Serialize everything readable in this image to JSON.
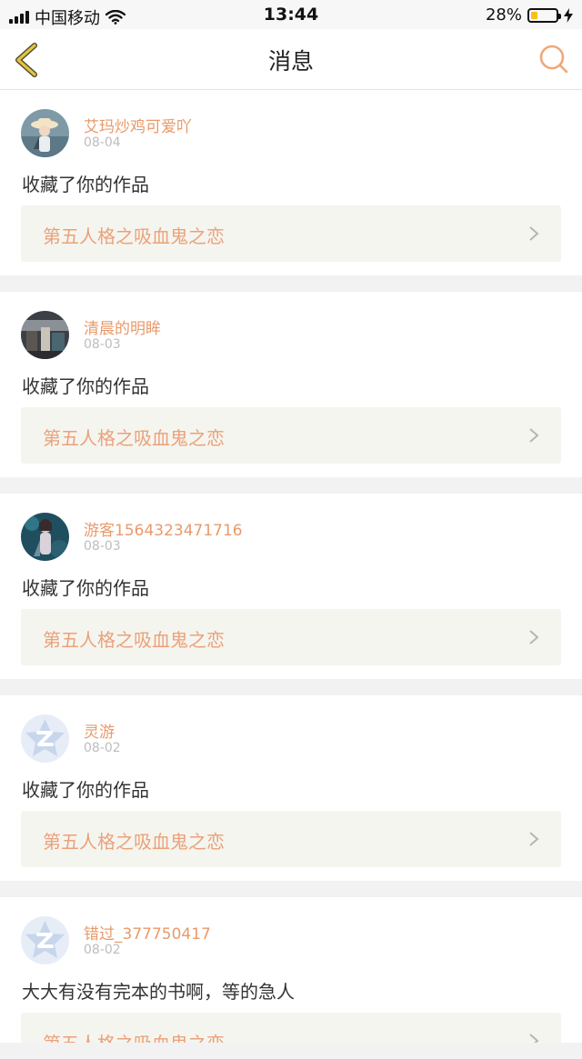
{
  "status_bar": {
    "carrier": "中国移动",
    "time": "13:44",
    "battery_percent": "28%",
    "battery_level": 0.28
  },
  "header": {
    "title": "消息",
    "back_icon": "chevron-left-icon",
    "search_icon": "search-icon"
  },
  "messages": [
    {
      "username": "艾玛炒鸡可爱吖",
      "date": "08-04",
      "action": "收藏了你的作品",
      "work_title": "第五人格之吸血鬼之恋"
    },
    {
      "username": "清晨的明眸",
      "date": "08-03",
      "action": "收藏了你的作品",
      "work_title": "第五人格之吸血鬼之恋"
    },
    {
      "username": "游客1564323471716",
      "date": "08-03",
      "action": "收藏了你的作品",
      "work_title": "第五人格之吸血鬼之恋"
    },
    {
      "username": "灵游",
      "date": "08-02",
      "action": "收藏了你的作品",
      "work_title": "第五人格之吸血鬼之恋"
    },
    {
      "username": "错过_377750417",
      "date": "08-02",
      "action": "大大有没有完本的书啊，等的急人",
      "work_title": "第五人格之吸血鬼之恋"
    }
  ],
  "colors": {
    "accent": "#e89a6b",
    "link_background": "#f5f5ef",
    "back_arrow": "#e5c243"
  }
}
